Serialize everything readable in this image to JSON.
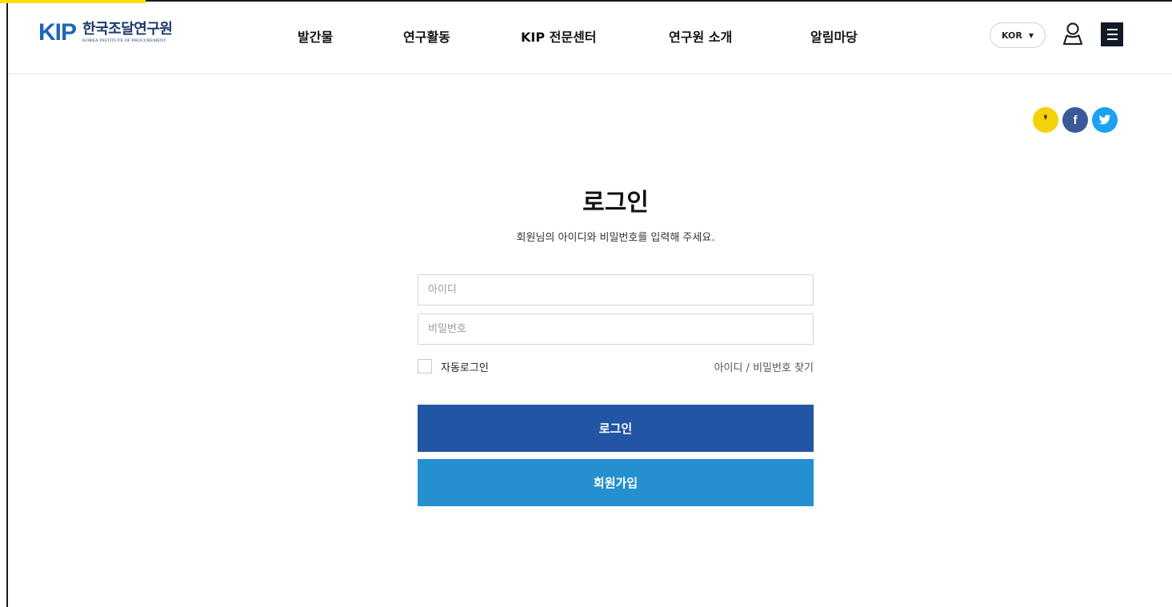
{
  "header": {
    "logo_mark": "KIP",
    "logo_name": "한국조달연구원",
    "logo_sub": "KOREA INSTITUTE OF PROCUREMENT",
    "nav": [
      "발간물",
      "연구활동",
      "KIP 전문센터",
      "연구원 소개",
      "알림마당"
    ],
    "language": "KOR",
    "language_caret": "▼"
  },
  "share": {
    "kakaostory": "❜",
    "facebook": "f",
    "twitter": "t"
  },
  "login": {
    "title": "로그인",
    "subtitle": "회원님의 아이디와 비밀번호를 입력해 주세요.",
    "id_placeholder": "아이디",
    "password_placeholder": "비밀번호",
    "auto_login": "자동로그인",
    "find_link": "아이디 / 비밀번호 찾기",
    "login_button": "로그인",
    "join_button": "회원가입"
  },
  "colors": {
    "brand": "#1f66b6",
    "login_button": "#2255a4",
    "join_button": "#2590d0",
    "kakao": "#f5d10a",
    "facebook": "#3b5998",
    "twitter": "#1da1f2"
  },
  "icons": [
    "user-icon",
    "hamburger-menu-icon",
    "kakaostory-icon",
    "facebook-icon",
    "twitter-icon"
  ]
}
